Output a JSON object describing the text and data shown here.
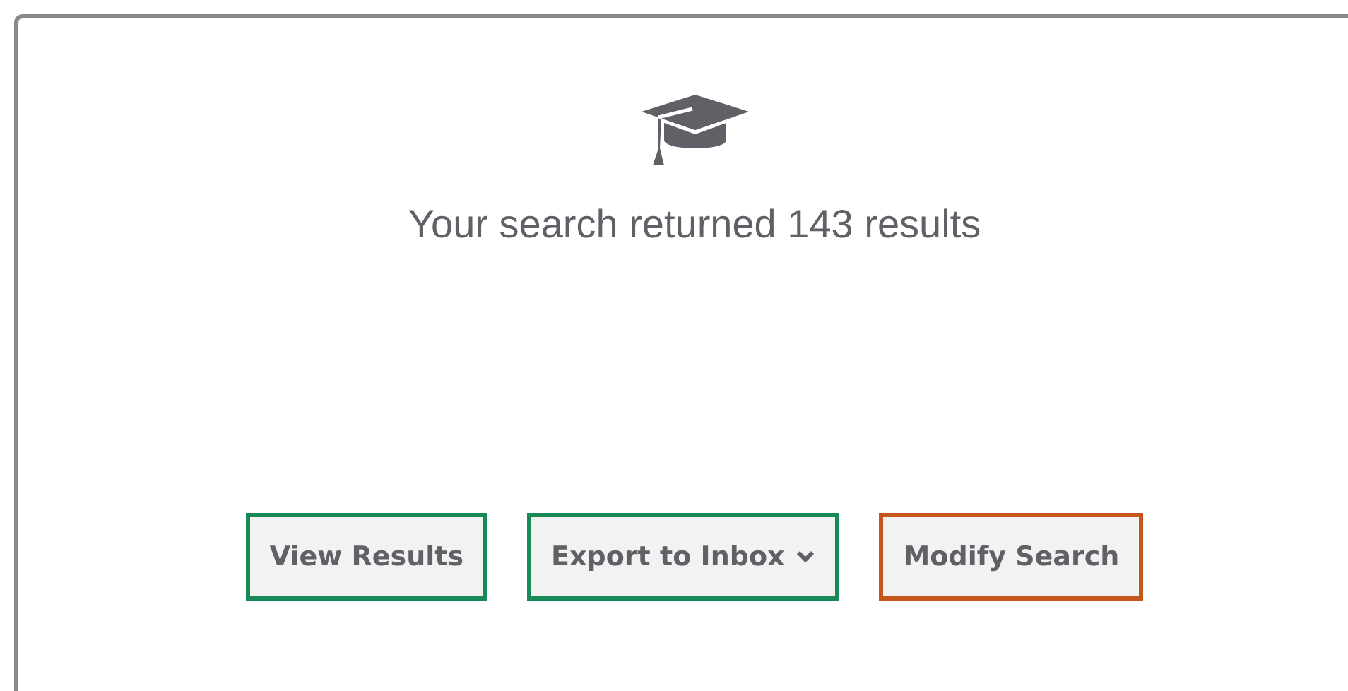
{
  "message": "Your search returned 143 results",
  "buttons": [
    {
      "label": "View Results",
      "kind": "plain",
      "color": "#178a58"
    },
    {
      "label": "Export to Inbox",
      "kind": "dropdown",
      "color": "#178a58"
    },
    {
      "label": "Modify Search",
      "kind": "plain",
      "color": "#c4561a"
    }
  ]
}
